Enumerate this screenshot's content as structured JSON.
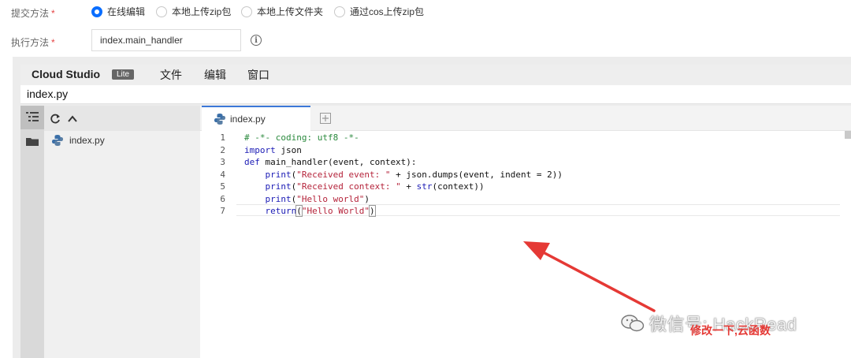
{
  "form": {
    "submit_label": "提交方法",
    "submit_required": "*",
    "submit_options": [
      "在线编辑",
      "本地上传zip包",
      "本地上传文件夹",
      "通过cos上传zip包"
    ],
    "selected_index": 0,
    "exec_label": "执行方法",
    "exec_required": "*",
    "exec_value": "index.main_handler"
  },
  "ide": {
    "brand": "Cloud Studio",
    "badge": "Lite",
    "menus": [
      "文件",
      "编辑",
      "窗口"
    ],
    "path": "index.py",
    "tree_file": "index.py",
    "tab_label": "index.py",
    "code": {
      "line_numbers": [
        "1",
        "2",
        "3",
        "4",
        "5",
        "6",
        "7"
      ],
      "l1": "# -*- coding: utf8 -*-",
      "l2_kw": "import",
      "l2_rest": " json",
      "l3_kw": "def",
      "l3_rest": " main_handler(event, context):",
      "l4_fn": "print",
      "l4_a": "(",
      "l4_s": "\"Received event: \"",
      "l4_b": " + json.dumps(event, indent = 2))",
      "l5_fn": "print",
      "l5_a": "(",
      "l5_s": "\"Received context: \"",
      "l5_b": " + ",
      "l5_fn2": "str",
      "l5_c": "(context))",
      "l6_fn": "print",
      "l6_a": "(",
      "l6_s": "\"Hello world\"",
      "l6_b": ")",
      "l7_fn": "return",
      "l7_a": "(",
      "l7_s": "\"Hello World\"",
      "l7_b": ")"
    }
  },
  "annotation": {
    "text": "修改一下,云函数",
    "color": "#e53935"
  },
  "watermark": {
    "text": "微信号: HackRead"
  },
  "colors": {
    "accent": "#0a6eff",
    "keyword": "#1b1bb5",
    "string": "#b5243b",
    "comment": "#2b8a3e"
  }
}
